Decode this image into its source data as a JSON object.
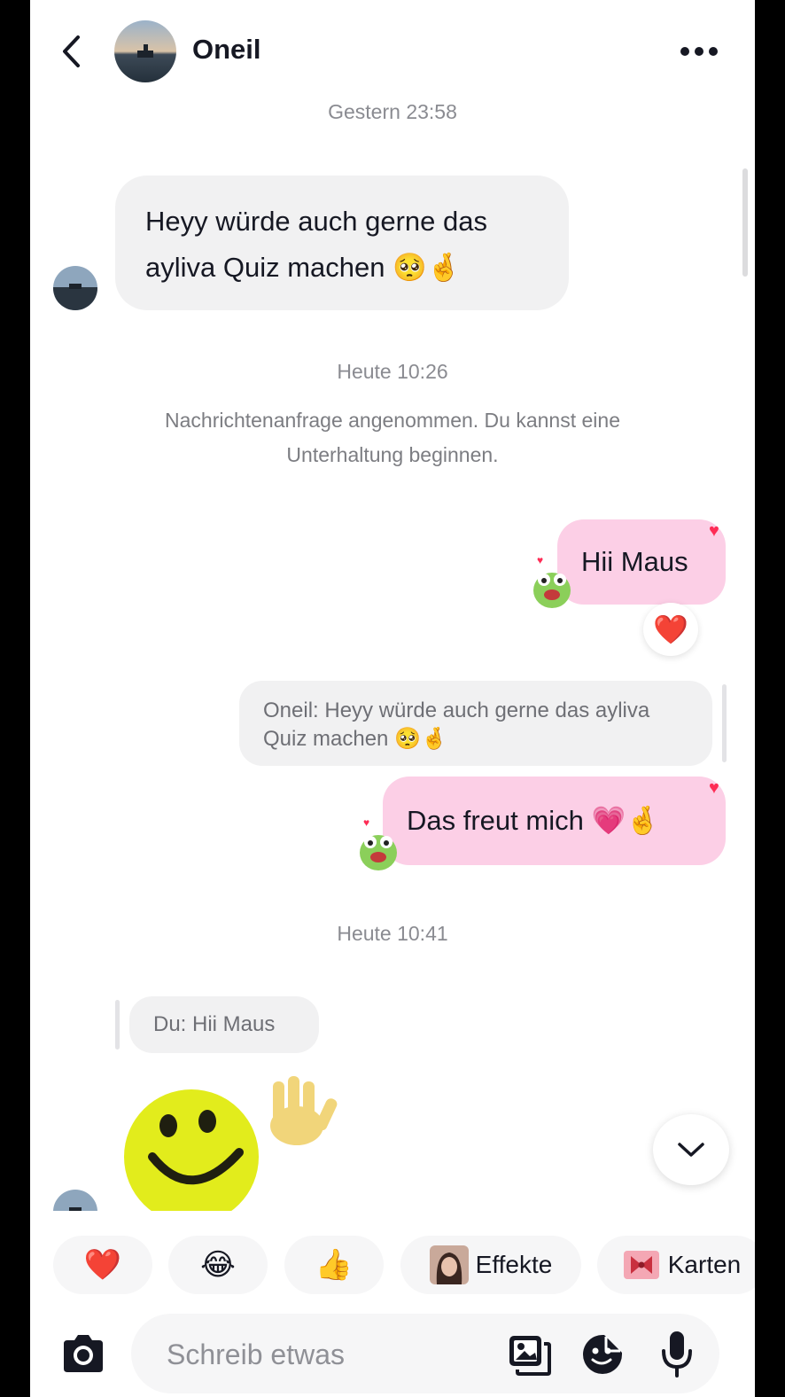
{
  "header": {
    "title": "Oneil",
    "back_icon": "chevron-left-icon",
    "more_icon": "more-horizontal-icon"
  },
  "messages": {
    "ts_yesterday": "Gestern 23:58",
    "incoming_1": "Heyy würde auch gerne das ayliva Quiz machen 🥺🤞",
    "ts_today_1": "Heute 10:26",
    "system_notice": "Nachrichtenanfrage angenommen. Du kannst eine Unterhaltung beginnen.",
    "outgoing_1": "Hii Maus",
    "outgoing_1_reaction": "❤️",
    "reply_quote_1": "Oneil: Heyy würde auch gerne das ayliva Quiz machen 🥺🤞",
    "outgoing_2": "Das freut mich 💗🤞",
    "ts_today_2": "Heute 10:41",
    "reply_quote_2": "Du: Hii Maus",
    "incoming_sticker": "waving-smiley-sticker"
  },
  "quick_reactions": {
    "heart": "❤️",
    "laugh": "😂",
    "thumbs": "👍",
    "effects_label": "Effekte",
    "cards_label": "Karten"
  },
  "composer": {
    "placeholder": "Schreib etwas",
    "camera_icon": "camera-icon",
    "gallery_icon": "image-gallery-icon",
    "sticker_icon": "sticker-icon",
    "mic_icon": "microphone-icon"
  },
  "colors": {
    "outgoing_bubble": "#fccfe6",
    "incoming_bubble": "#f1f1f2",
    "accent_heart": "#fe2c55"
  }
}
